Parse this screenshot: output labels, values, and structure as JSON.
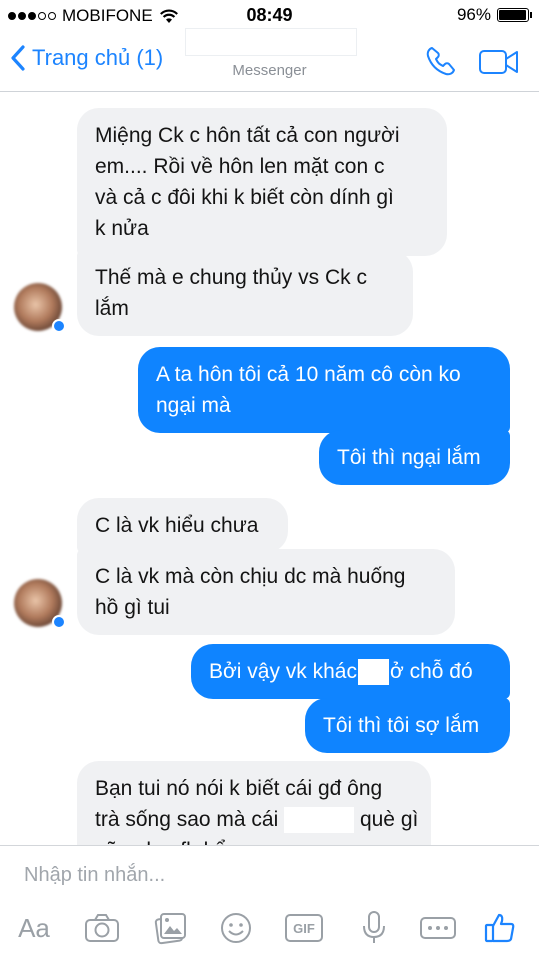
{
  "status_bar": {
    "carrier": "MOBIFONE",
    "time": "08:49",
    "battery": "96%",
    "battery_level": 0.96
  },
  "header": {
    "back_label": "Trang chủ (1)",
    "subtitle": "Messenger"
  },
  "messages": [
    {
      "side": "in",
      "text": "Miệng Ck c hôn tất cả con người\nem.... Rồi về hôn len mặt con c\nvà cả c đôi khi k biết còn dính gì\nk nửa"
    },
    {
      "side": "in",
      "text": "Thế mà e chung thủy vs Ck c\nlắm"
    },
    {
      "side": "out",
      "text": "A ta hôn tôi cả 10 năm cô còn ko\nngại mà"
    },
    {
      "side": "out",
      "text": "Tôi thì ngại lắm"
    },
    {
      "side": "in",
      "text": "C là vk hiểu chưa"
    },
    {
      "side": "in",
      "text": "C là vk mà còn chịu dc mà huống\nhồ gì tui"
    },
    {
      "side": "out",
      "text_before": "Bởi vậy vk khác",
      "text_after": "ở chỗ đó"
    },
    {
      "side": "out",
      "text": "Tôi thì tôi sợ lắm"
    },
    {
      "side": "in",
      "line1": "Bạn tui nó nói k biết cái gđ ông",
      "line2_before": "trà sống sao mà cái",
      "line2_after": "què gì",
      "line3": "cũng len fb kể"
    }
  ],
  "composer": {
    "placeholder": "Nhập tin nhắn...",
    "aa_label": "Aa",
    "gif_label": "GIF"
  },
  "toolbar_icons": [
    "aa-icon",
    "camera-icon",
    "gallery-icon",
    "emoji-icon",
    "gif-icon",
    "mic-icon",
    "more-icon",
    "like-icon"
  ],
  "colors": {
    "accent": "#1c84ff",
    "outgoing_bubble": "#0f84ff",
    "incoming_bubble": "#f0f1f3"
  }
}
